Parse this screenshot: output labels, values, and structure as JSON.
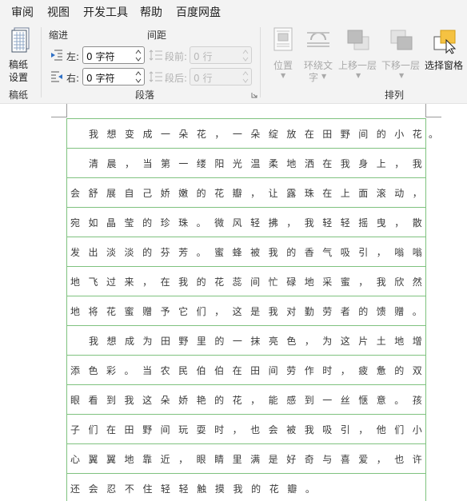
{
  "menu": {
    "items": [
      "审阅",
      "视图",
      "开发工具",
      "帮助",
      "百度网盘"
    ]
  },
  "ribbon": {
    "manuscript": {
      "button_label_line1": "稿纸",
      "button_label_line2": "设置",
      "group_label": "稿纸"
    },
    "paragraph": {
      "indent_label": "缩进",
      "spacing_label": "间距",
      "left_label": "左:",
      "left_value": "0 字符",
      "right_label": "右:",
      "right_value": "0 字符",
      "before_label": "段前:",
      "before_value": "0 行",
      "after_label": "段后:",
      "after_value": "0 行",
      "group_label": "段落"
    },
    "arrange": {
      "position_label": "位置",
      "wrap_label_line1": "环绕文",
      "wrap_label_line2": "字",
      "bring_forward_label": "上移一层",
      "send_backward_label": "下移一层",
      "selection_pane_label": "选择窗格",
      "group_label": "排列"
    }
  },
  "document": {
    "lines": [
      "我想变成一朵花，一朵绽放在田野间的小花",
      "清晨，当第一缕阳光温柔地洒在我身上，我",
      "会舒展自己娇嫩的花瓣，让露珠在上面滚动，",
      "宛如晶莹的珍珠。微风轻拂，我轻轻摇曳，散",
      "发出淡淡的芬芳。蜜蜂被我的香气吸引，嗡嗡",
      "地飞过来，在我的花蕊间忙碌地采蜜，我欣然",
      "地将花蜜赠予它们，这是我对勤劳者的馈赠。",
      "我想成为田野里的一抹亮色，为这片土地增",
      "添色彩。当农民伯伯在田间劳作时，疲惫的双",
      "眼看到我这朵娇艳的花，能感到一丝惬意。孩",
      "子们在田野间玩耍时，也会被我吸引，他们小",
      "心翼翼地靠近，眼睛里满是好奇与喜爱，也许",
      "还会忍不住轻轻触摸我的花瓣。"
    ],
    "overflow_punct": "。"
  },
  "colors": {
    "grid_line": "#7fc27f",
    "ribbon_bg": "#f3f3f3",
    "accent_yellow": "#f5c242"
  }
}
